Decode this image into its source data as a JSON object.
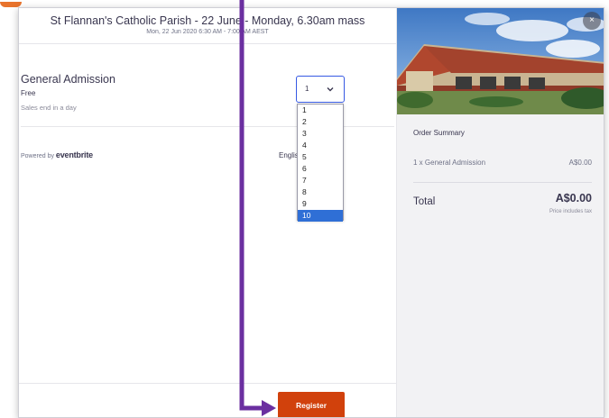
{
  "event": {
    "title": "St Flannan's Catholic Parish - 22 June - Monday, 6.30am mass",
    "date_line": "Mon, 22 Jun 2020 6:30 AM - 7:00 AM AEST"
  },
  "ticket": {
    "name": "General Admission",
    "price": "Free",
    "sales_note": "Sales end in a day",
    "quantity_selected": "1",
    "quantity_options": [
      "1",
      "2",
      "3",
      "4",
      "5",
      "6",
      "7",
      "8",
      "9",
      "10"
    ],
    "highlighted_option": "10"
  },
  "footer": {
    "powered_by": "Powered by",
    "brand": "eventbrite",
    "language": "English",
    "register_label": "Register"
  },
  "summary": {
    "title": "Order Summary",
    "line_item": "1 x General Admission",
    "line_amount": "A$0.00",
    "total_label": "Total",
    "total_amount": "A$0.00",
    "tax_note": "Price includes tax"
  },
  "close_label": "×",
  "colors": {
    "accent_orange": "#d1410c",
    "annotation_purple": "#6b2fa0",
    "selection_blue": "#2f6fd6",
    "focus_blue": "#3659e3"
  }
}
